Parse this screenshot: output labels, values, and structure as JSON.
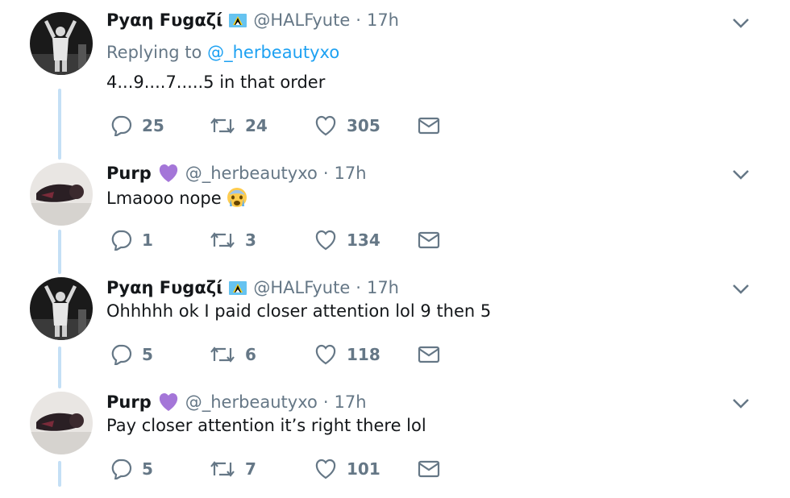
{
  "tweets": [
    {
      "display_name": "Ρyαη Fυgαζί",
      "handle": "@HALFyute",
      "separator": "·",
      "time": "17h",
      "reply_prefix": "Replying to",
      "reply_handle": "@_herbeautyxo",
      "text": "4...9....7.....5 in that order",
      "badge_icon": "flag-icon",
      "replies": "25",
      "retweets": "24",
      "likes": "305"
    },
    {
      "display_name": "Purp",
      "handle": "@_herbeautyxo",
      "separator": "·",
      "time": "17h",
      "text": "Lmaooo nope",
      "badge_icon": "purple-heart-icon",
      "emoji": "crying-face-emoji",
      "replies": "1",
      "retweets": "3",
      "likes": "134"
    },
    {
      "display_name": "Ρyαη Fυgαζί",
      "handle": "@HALFyute",
      "separator": "·",
      "time": "17h",
      "text": "Ohhhhh ok I paid closer attention lol 9 then 5",
      "badge_icon": "flag-icon",
      "replies": "5",
      "retweets": "6",
      "likes": "118"
    },
    {
      "display_name": "Purp",
      "handle": "@_herbeautyxo",
      "separator": "·",
      "time": "17h",
      "text": "Pay closer attention it’s right there lol",
      "badge_icon": "purple-heart-icon",
      "replies": "5",
      "retweets": "7",
      "likes": "101"
    }
  ],
  "colors": {
    "text": "#14171a",
    "secondary": "#657786",
    "link": "#1da1f2",
    "thread_line": "#c4dff5",
    "purple_heart": "#a476d8"
  }
}
